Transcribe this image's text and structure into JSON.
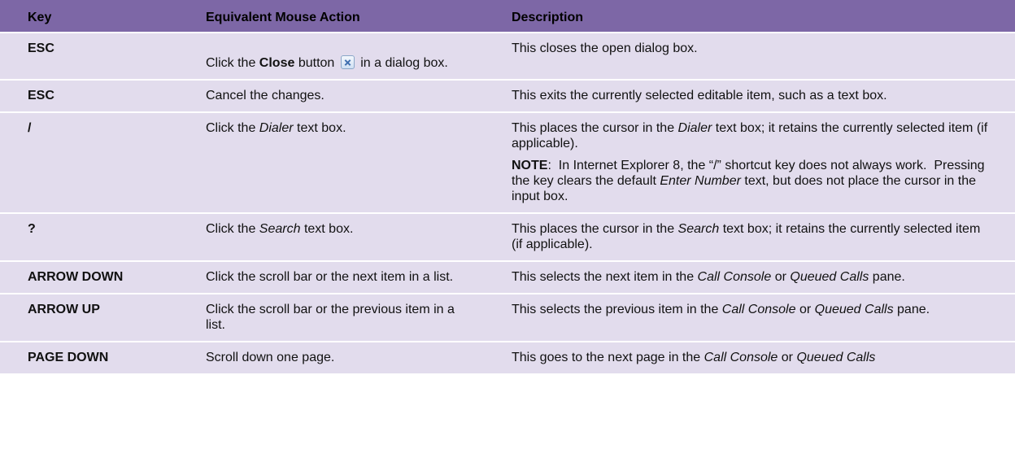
{
  "header": {
    "col_key": "Key",
    "col_action": "Equivalent Mouse Action",
    "col_desc": "Description"
  },
  "icons": {
    "close": "close-x-icon"
  },
  "colors": {
    "header_bg": "#7d67a6",
    "row_bg": "#e2dced"
  },
  "rows": [
    {
      "key": "ESC",
      "action": {
        "pre": "Click the ",
        "bold": "Close",
        "mid": " button ",
        "post": " in a dialog box."
      },
      "desc": "This closes the open dialog box."
    },
    {
      "key": "ESC",
      "action": "Cancel the changes.",
      "desc": "This exits the currently selected editable item, such as a text box."
    },
    {
      "key": "/",
      "action": {
        "pre": "Click the ",
        "em": "Dialer",
        "post": " text box."
      },
      "desc": {
        "pre": "This places the cursor in the ",
        "em": "Dialer",
        "post": " text box; it retains the currently selected item (if applicable)."
      },
      "note": {
        "label": "NOTE",
        "pre": ":  In Internet Explorer 8, the “/” shortcut key does not always work.  Pressing the key clears the default ",
        "em": "Enter Number",
        "post": " text, but does not place the cursor in the input box."
      }
    },
    {
      "key": "?",
      "action": {
        "pre": "Click the ",
        "em": "Search",
        "post": " text box."
      },
      "desc": {
        "pre": "This places the cursor in the ",
        "em": "Search",
        "post": " text box; it retains the currently selected item (if applicable)."
      }
    },
    {
      "key": "ARROW DOWN",
      "action": "Click the scroll bar or the next item in a list.",
      "desc": {
        "pre": "This selects the next item in the ",
        "em1": "Call Console",
        "mid": " or ",
        "em2": "Queued Calls",
        "post": " pane."
      }
    },
    {
      "key": "ARROW UP",
      "action": "Click the scroll bar or the previous item in a list.",
      "desc": {
        "pre": "This selects the previous item in the ",
        "em1": "Call Console",
        "mid": " or ",
        "em2": "Queued Calls",
        "post": " pane."
      }
    },
    {
      "key": "PAGE DOWN",
      "action": "Scroll down one page.",
      "desc": {
        "pre": "This goes to the next page in the ",
        "em1": "Call Console",
        "mid": " or ",
        "em2": "Queued Calls",
        "post": ""
      }
    }
  ]
}
